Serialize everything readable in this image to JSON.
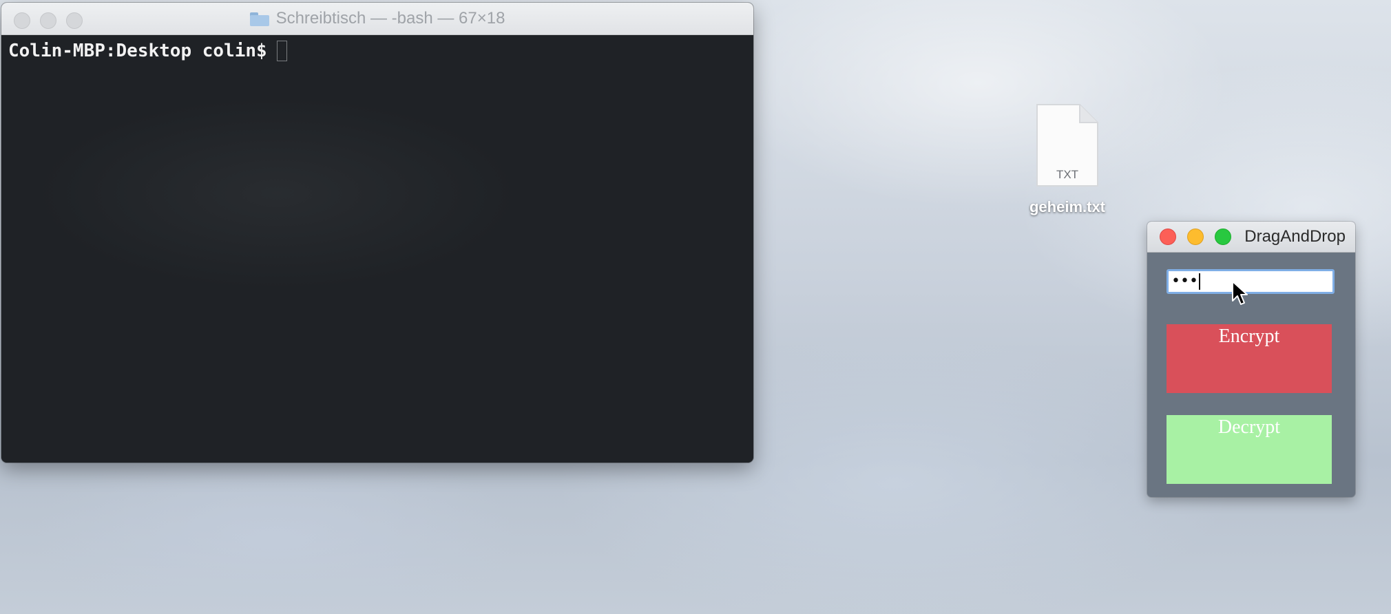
{
  "terminal": {
    "title": "Schreibtisch — -bash — 67×18",
    "prompt": "Colin-MBP:Desktop colin$"
  },
  "desktop": {
    "file": {
      "name": "geheim.txt",
      "ext": "TXT",
      "icon": "text-document-icon"
    }
  },
  "dragandrop": {
    "title": "DragAndDrop",
    "password_value": "•••",
    "encrypt_label": "Encrypt",
    "decrypt_label": "Decrypt",
    "colors": {
      "encrypt": "#d9505a",
      "decrypt": "#a8f1a4",
      "window_bg": "#6a7582"
    }
  }
}
